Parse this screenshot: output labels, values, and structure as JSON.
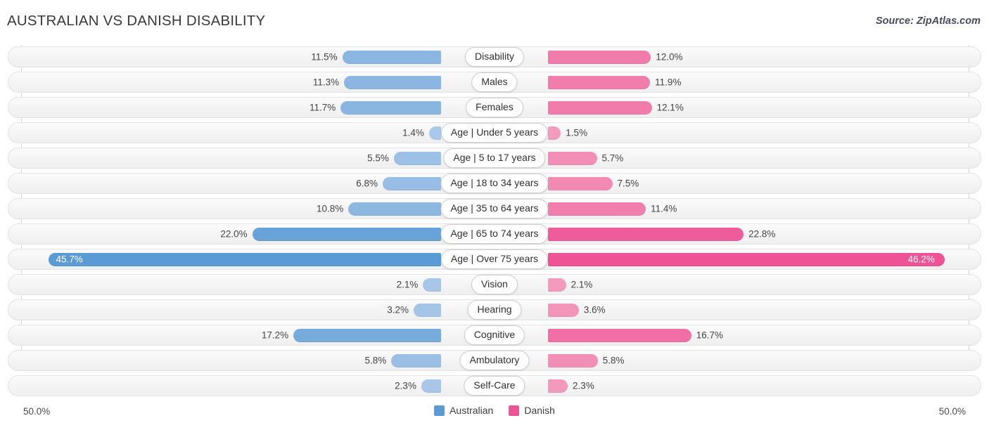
{
  "header": {
    "title": "AUSTRALIAN VS DANISH DISABILITY",
    "source": "Source: ZipAtlas.com"
  },
  "axis": {
    "left_label": "50.0%",
    "right_label": "50.0%"
  },
  "legend": {
    "items": [
      {
        "label": "Australian",
        "color": "#5b9bd5"
      },
      {
        "label": "Danish",
        "color": "#ee5396"
      }
    ]
  },
  "colors": {
    "australian": "#5b9bd5",
    "danish": "#ee5396",
    "australian_light": "#afcbea",
    "danish_light": "#f4a0bf",
    "track": "#f4f4f4",
    "gridline": "#d8d8d8"
  },
  "chart_data": {
    "type": "bar",
    "subtype": "diverging-bar",
    "title": "AUSTRALIAN VS DANISH DISABILITY",
    "xlabel": "",
    "ylabel": "",
    "xlim": [
      0,
      50
    ],
    "axis_max_percent": 50.0,
    "grid": true,
    "legend_position": "bottom-center",
    "categories": [
      "Disability",
      "Males",
      "Females",
      "Age | Under 5 years",
      "Age | 5 to 17 years",
      "Age | 18 to 34 years",
      "Age | 35 to 64 years",
      "Age | 65 to 74 years",
      "Age | Over 75 years",
      "Vision",
      "Hearing",
      "Cognitive",
      "Ambulatory",
      "Self-Care"
    ],
    "series": [
      {
        "name": "Australian",
        "color": "#5b9bd5",
        "side": "left",
        "values": [
          11.5,
          11.3,
          11.7,
          1.4,
          5.5,
          6.8,
          10.8,
          22.0,
          45.7,
          2.1,
          3.2,
          17.2,
          5.8,
          2.3
        ],
        "labels": [
          "11.5%",
          "11.3%",
          "11.7%",
          "1.4%",
          "5.5%",
          "6.8%",
          "10.8%",
          "22.0%",
          "45.7%",
          "2.1%",
          "3.2%",
          "17.2%",
          "5.8%",
          "2.3%"
        ]
      },
      {
        "name": "Danish",
        "color": "#ee5396",
        "side": "right",
        "values": [
          12.0,
          11.9,
          12.1,
          1.5,
          5.7,
          7.5,
          11.4,
          22.8,
          46.2,
          2.1,
          3.6,
          16.7,
          5.8,
          2.3
        ],
        "labels": [
          "12.0%",
          "11.9%",
          "12.1%",
          "1.5%",
          "5.7%",
          "7.5%",
          "11.4%",
          "22.8%",
          "46.2%",
          "2.1%",
          "3.6%",
          "16.7%",
          "5.8%",
          "2.3%"
        ]
      }
    ]
  }
}
